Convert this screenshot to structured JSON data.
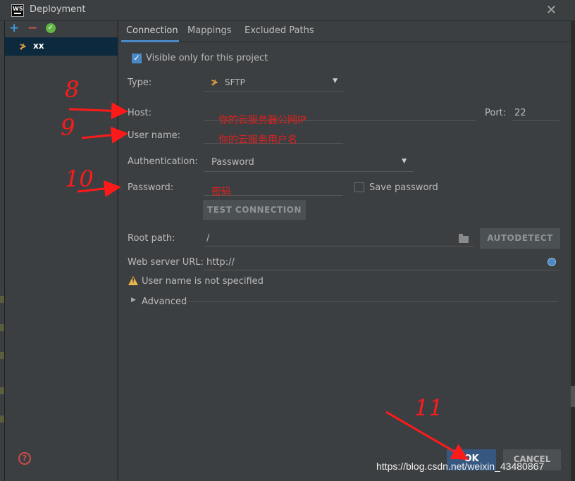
{
  "window": {
    "title": "Deployment",
    "logo_text": "WS"
  },
  "left_panel": {
    "server_name": "xx"
  },
  "tabs": [
    "Connection",
    "Mappings",
    "Excluded Paths"
  ],
  "form": {
    "visible_only_label": "Visible only for this project",
    "visible_only_checked": true,
    "type_label": "Type:",
    "type_value": "SFTP",
    "host_label": "Host:",
    "host_value": "",
    "port_label": "Port:",
    "port_value": "22",
    "username_label": "User name:",
    "username_value": "",
    "auth_label": "Authentication:",
    "auth_value": "Password",
    "password_label": "Password:",
    "save_password_label": "Save password",
    "save_password_checked": false,
    "test_connection": "TEST CONNECTION",
    "root_path_label": "Root path:",
    "root_path_value": "/",
    "autodetect": "AUTODETECT",
    "web_url_label": "Web server URL:",
    "web_url_value": "http://",
    "warning": "User name is not specified",
    "advanced": "Advanced"
  },
  "annotations": {
    "host_note": "你的云服务器公网IP",
    "username_note": "你的云服务用户名",
    "password_note": "密码",
    "num_8": "8",
    "num_9": "9",
    "num_10": "10",
    "num_11": "11"
  },
  "buttons": {
    "ok": "OK",
    "cancel": "CANCEL"
  },
  "watermark": "https://blog.csdn.net/weixin_43480867",
  "colors": {
    "accent": "#4a88c7",
    "annotation": "#e02020",
    "ok_button": "#365880"
  }
}
